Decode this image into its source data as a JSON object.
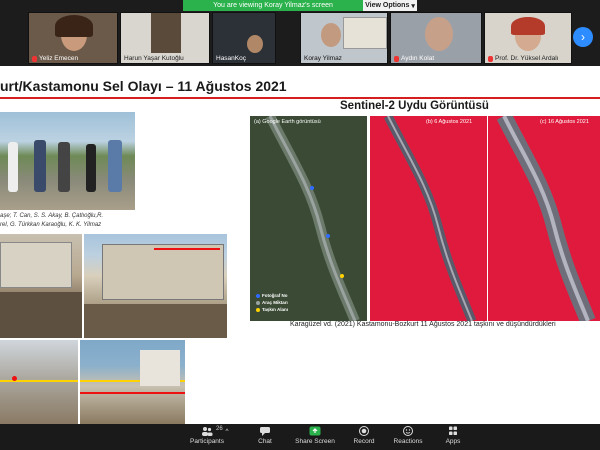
{
  "banner": {
    "viewing": "You are viewing Koray Yilmaz's screen",
    "view_options": "View Options",
    "view_options_chevron": "▾"
  },
  "participants_strip": {
    "tiles": [
      {
        "name": "Yeliz Emecen",
        "muted": true
      },
      {
        "name": "Harun Yaşar Kutoğlu",
        "muted": false
      },
      {
        "name": "HasanKoç",
        "muted": false
      },
      {
        "name": "Koray Yilmaz",
        "muted": false
      },
      {
        "name": "Aydın Kolat",
        "muted": true
      },
      {
        "name": "Prof. Dr. Yüksel Ardalı",
        "muted": true
      }
    ],
    "next_icon": "chevron-right-icon",
    "next_glyph": "›"
  },
  "slide": {
    "title": "urt/Kastamonu Sel Olayı – 11 Ağustos 2021",
    "subheading": "Sentinel-2 Uydu Görüntüsü",
    "photo_credits": [
      "aşe; T. Can, S. S. Akay, B. Çatlıoğlu,R.",
      "rel, G. Türkkan Karaoğlu, K. K. Yilmaz"
    ],
    "map_panels": [
      {
        "label": "(a) Google Earth görüntüsü",
        "type": "true-color"
      },
      {
        "label": "(b) 6 Ağustos 2021",
        "type": "false-color"
      },
      {
        "label": "(c) 16 Ağustos 2021",
        "type": "false-color"
      }
    ],
    "map_legend": [
      "Fotoğraf No",
      "Araç Miktarı",
      "Taşkın Alanı"
    ],
    "caption": "Karagüzel vd. (2021) Kastamonu-Bozkurt 11 Ağustos 2021 taşkını ve düşündürdükleri"
  },
  "toolbar": {
    "participants_count": "26",
    "caret": "^",
    "items": [
      {
        "label": "Participants",
        "icon": "participants-icon"
      },
      {
        "label": "Chat",
        "icon": "chat-icon"
      },
      {
        "label": "Share Screen",
        "icon": "share-screen-icon"
      },
      {
        "label": "Record",
        "icon": "record-icon"
      },
      {
        "label": "Reactions",
        "icon": "reactions-icon"
      },
      {
        "label": "Apps",
        "icon": "apps-icon"
      }
    ]
  },
  "colors": {
    "share_green": "#2bb24c",
    "accent_blue": "#2d8cff",
    "title_red": "#d51f1f",
    "false_color_red": "#e01a3c"
  }
}
